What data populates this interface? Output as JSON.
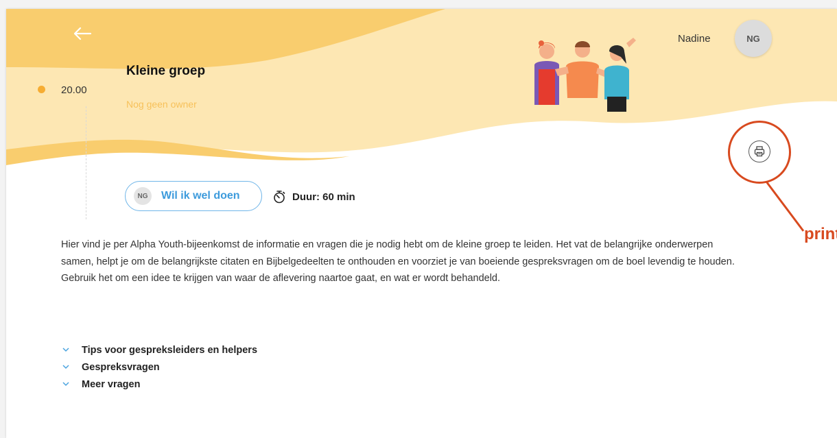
{
  "header": {
    "back_icon": "arrow-left-icon",
    "time": "20.00",
    "title": "Kleine groep",
    "owner": "Nog geen owner",
    "user_name": "Nadine",
    "user_initials": "NG",
    "illustration": "three-people-illustration"
  },
  "actions": {
    "print_icon": "printer-icon",
    "annotation_label": "printl",
    "annotation_color": "#d84a1f"
  },
  "participation": {
    "avatar_initials": "NG",
    "label": "Wil ik wel doen",
    "accent": "#3d9bdc"
  },
  "duration": {
    "icon": "stopwatch-icon",
    "label": "Duur: 60 min"
  },
  "description": "Hier vind je per Alpha Youth-bijeenkomst de informatie en vragen die je nodig hebt om de kleine groep te leiden. Het vat de belangrijke onderwerpen samen, helpt je om de belangrijkste citaten en Bijbelgedeelten te onthouden en voorziet je van boeiende gespreksvragen om de boel levendig te houden. Gebruik het om een idee te krijgen van waar de aflevering naartoe gaat, en wat er wordt behandeld.",
  "accordion": [
    {
      "label": "Tips voor gespreksleiders en helpers"
    },
    {
      "label": "Gespreksvragen"
    },
    {
      "label": "Meer vragen"
    }
  ],
  "colors": {
    "hero_light": "#fde7b3",
    "hero_dark": "#f9cd6e",
    "dot": "#f6ad33"
  }
}
